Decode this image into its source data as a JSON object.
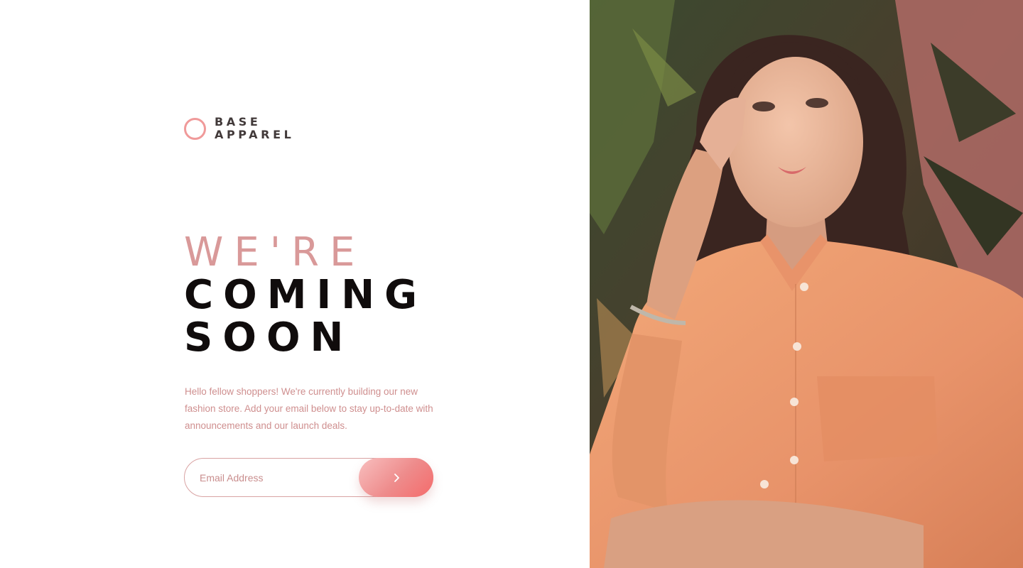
{
  "brand": {
    "line1": "BASE",
    "line2": "APPAREL",
    "accent_color": "#f09a9a"
  },
  "headline": {
    "line1": "WE'RE",
    "line2": "COMING",
    "line3": "SOON"
  },
  "description": "Hello fellow shoppers! We're currently building our new fashion store. Add your email below to stay up-to-date with announcements and our launch deals.",
  "signup": {
    "placeholder": "Email Address",
    "submit_icon": "chevron-right-icon",
    "button_color": "#f56b6b"
  },
  "hero": {
    "subject": "woman in orange shirt",
    "shirt_color": "#f2a878"
  }
}
